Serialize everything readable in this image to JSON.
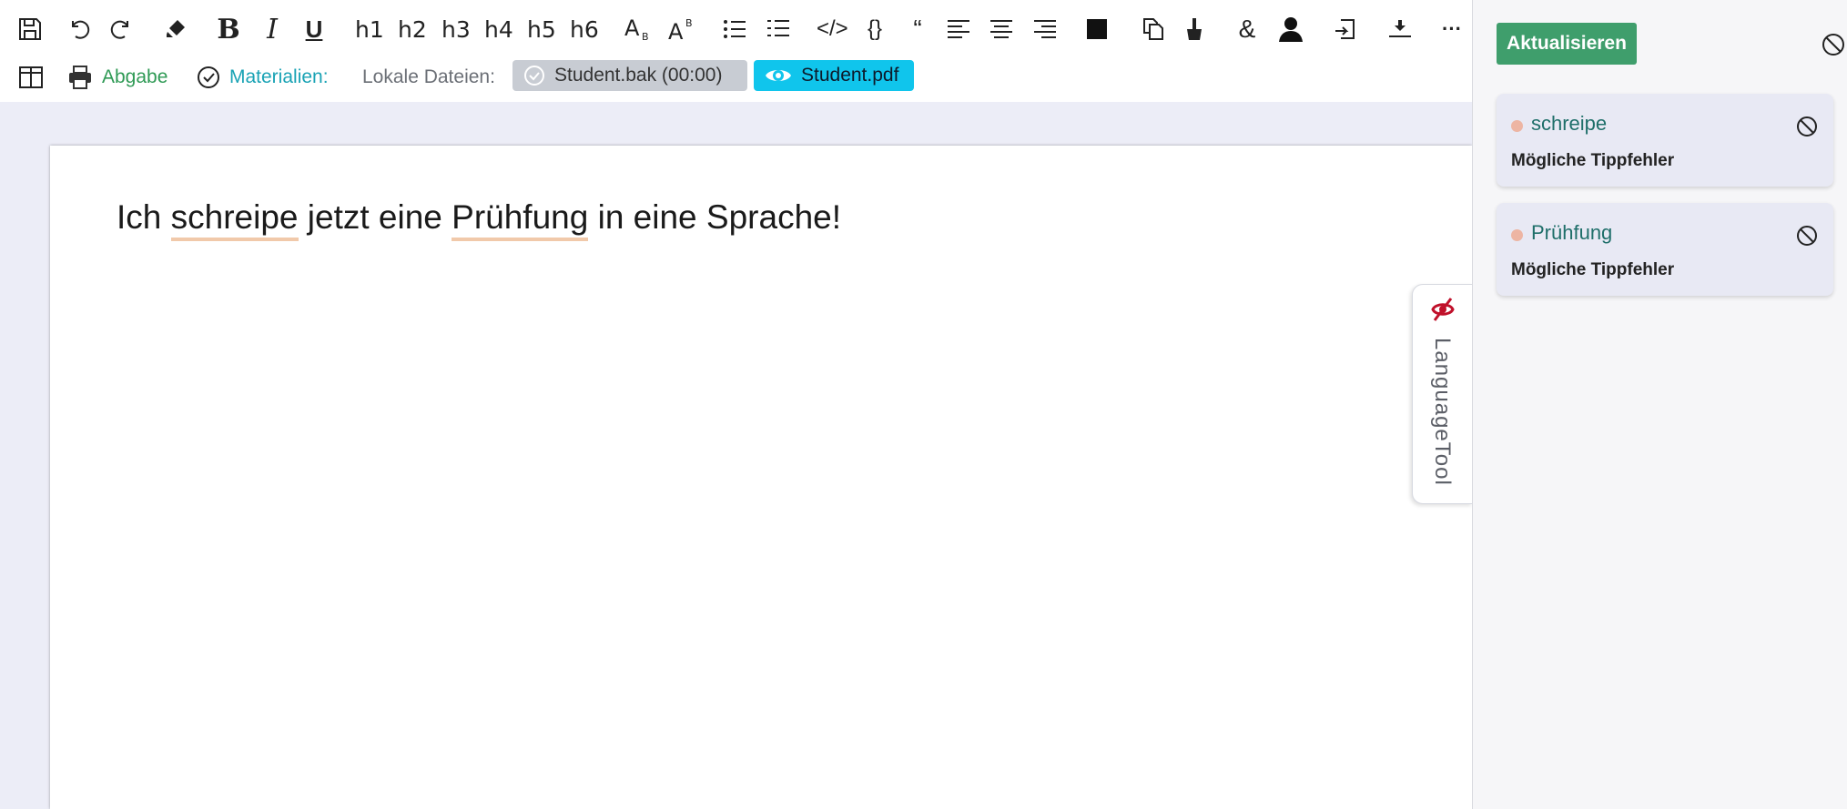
{
  "toolbar": {
    "headings": [
      "h1",
      "h2",
      "h3",
      "h4",
      "h5",
      "h6"
    ],
    "quote_glyph": "“",
    "ampersand_glyph": "&",
    "more_glyph": "···"
  },
  "subbar": {
    "abgabe_label": "Abgabe",
    "materialien_label": "Materialien:",
    "lokale_label": "Lokale Dateien:",
    "files": [
      {
        "name": "Student.bak (00:00)",
        "icon": "check-circle-icon"
      },
      {
        "name": "Student.pdf",
        "icon": "eye-icon"
      }
    ]
  },
  "document": {
    "before": "Ich ",
    "error1": "schreipe",
    "middle": " jetzt eine ",
    "error2": "Prühfung",
    "after": " in eine Sprache!"
  },
  "languagetool": {
    "tab_label": "LanguageTool",
    "refresh_label": "Aktualisieren",
    "suggestions": [
      {
        "word": "schreipe",
        "type": "Mögliche Tippfehler"
      },
      {
        "word": "Prühfung",
        "type": "Mögliche Tippfehler"
      }
    ]
  },
  "colors": {
    "accent_green": "#3f9e6c",
    "link_green": "#2f9a55",
    "teal": "#1aa3b5",
    "pdf_chip": "#10c5ec",
    "error_underline": "#f1c9aa",
    "card_bg": "#e8e9f4"
  }
}
